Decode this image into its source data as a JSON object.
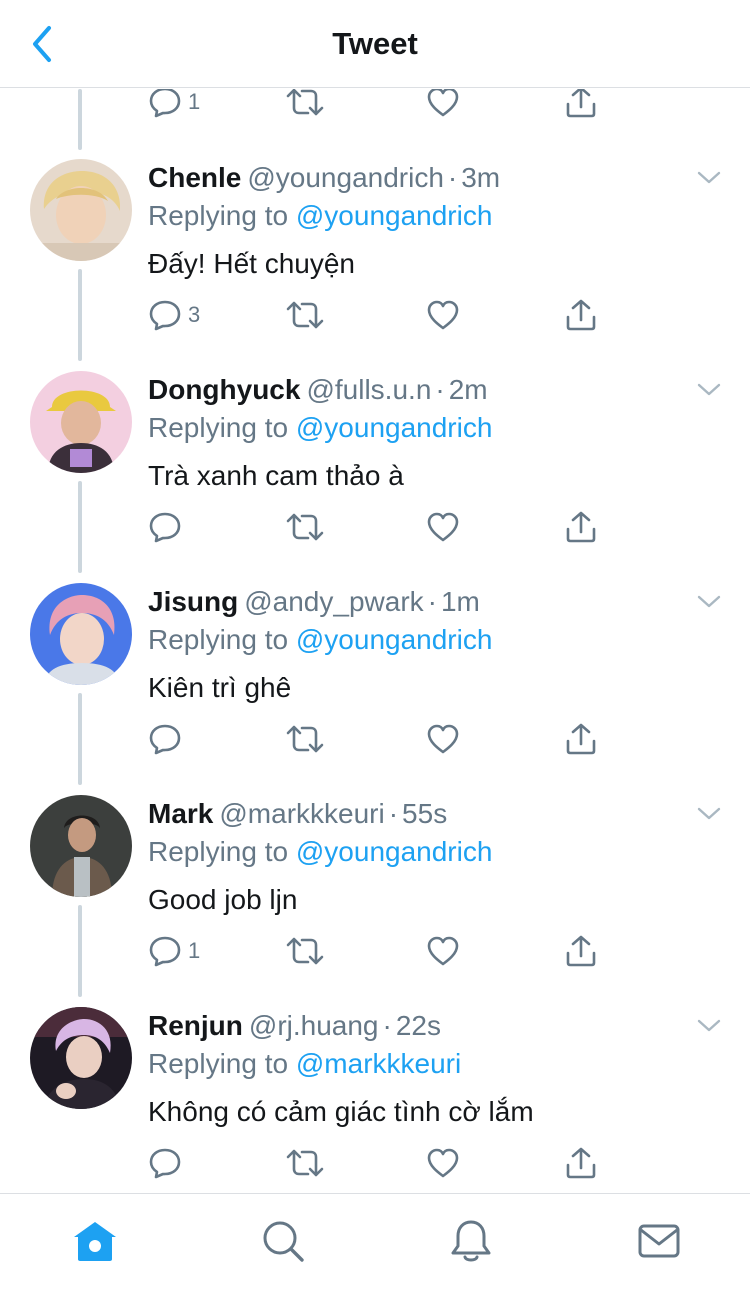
{
  "header": {
    "title": "Tweet"
  },
  "top_partial": {
    "reply_count": "1"
  },
  "tweets": [
    {
      "name": "Chenle",
      "handle": "@youngandrich",
      "dot": "·",
      "time": "3m",
      "replying_prefix": "Replying to",
      "replying_to": "@youngandrich",
      "text": "Đấy! Hết chuyện",
      "reply_count": "3"
    },
    {
      "name": "Donghyuck",
      "handle": "@fulls.u.n",
      "dot": "·",
      "time": "2m",
      "replying_prefix": "Replying to",
      "replying_to": "@youngandrich",
      "text": "Trà xanh cam thảo à",
      "reply_count": ""
    },
    {
      "name": "Jisung",
      "handle": "@andy_pwark",
      "dot": "·",
      "time": "1m",
      "replying_prefix": "Replying to",
      "replying_to": "@youngandrich",
      "text": "Kiên trì ghê",
      "reply_count": ""
    },
    {
      "name": "Mark",
      "handle": "@markkkeuri",
      "dot": "·",
      "time": "55s",
      "replying_prefix": "Replying to",
      "replying_to": "@youngandrich",
      "text": "Good job ljn",
      "reply_count": "1"
    },
    {
      "name": "Renjun",
      "handle": "@rj.huang",
      "dot": "·",
      "time": "22s",
      "replying_prefix": "Replying to",
      "replying_to": "@markkkeuri",
      "text": "Không có cảm giác tình cờ lắm",
      "reply_count": ""
    }
  ],
  "colors": {
    "accent": "#1da1f2",
    "icon_gray": "#657786",
    "text": "#14171a",
    "thread_line": "#ccd6dd"
  },
  "icons": {
    "back": "chevron-left-icon",
    "reply": "reply-icon",
    "retweet": "retweet-icon",
    "like": "heart-icon",
    "share": "share-icon",
    "more": "chevron-down-icon",
    "tabs": [
      "home-icon",
      "search-icon",
      "bell-icon",
      "mail-icon"
    ]
  }
}
